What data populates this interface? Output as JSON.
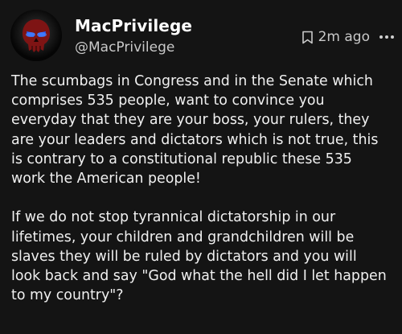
{
  "post": {
    "author_name": "MacPrivilege",
    "author_handle": "@MacPrivilege",
    "timestamp": "2m ago",
    "icons": {
      "avatar": "punisher-skull-avatar",
      "bookmark": "bookmark-icon",
      "more": "more-options-icon"
    },
    "paragraphs": [
      "The scumbags in Congress and in the Senate which\ncomprises 535 people, want to convince you\neveryday that they are your boss, your rulers, they\nare your leaders and dictators which is not true, this\nis contrary to a constitutional republic these 535\nwork the American people!",
      "If we do not stop tyrannical dictatorship in our\nlifetimes, your children and grandchildren will be\nslaves they will be ruled by dictators and you will\nlook back and say \"God what the hell did I let happen\nto my country\"?"
    ]
  },
  "colors": {
    "background": "#141414",
    "text": "#f0f0f0",
    "muted": "#c9c9c9",
    "avatar_eyes": "#2a6bff",
    "avatar_skull": "#8b1a1a"
  }
}
